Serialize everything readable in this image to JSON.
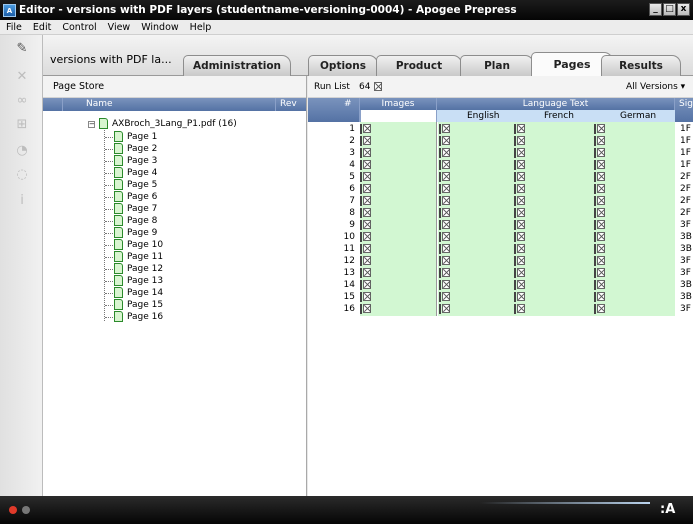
{
  "window": {
    "title": "Editor - versions with PDF layers (studentname-versioning-0004) - Apogee Prepress",
    "app_icon": "A",
    "minimize_label": "_",
    "restore_label": "□",
    "close_label": "x"
  },
  "menu": {
    "items": [
      "File",
      "Edit",
      "Control",
      "View",
      "Window",
      "Help"
    ]
  },
  "tabs": {
    "path_label": "versions with PDF la...",
    "items": [
      "Administration",
      "Options",
      "Product",
      "Plan",
      "Pages",
      "Results"
    ],
    "active": "Pages"
  },
  "page_store": {
    "title": "Page Store",
    "col_name": "Name",
    "col_rev": "Rev",
    "root_label": "AXBroch_3Lang_P1.pdf (16)",
    "pages": [
      "Page 1",
      "Page 2",
      "Page 3",
      "Page 4",
      "Page 5",
      "Page 6",
      "Page 7",
      "Page 8",
      "Page 9",
      "Page 10",
      "Page 11",
      "Page 12",
      "Page 13",
      "Page 14",
      "Page 15",
      "Page 16"
    ]
  },
  "run_list": {
    "label": "Run List",
    "count": "64",
    "versions_dropdown": "All Versions"
  },
  "grid": {
    "header_num": "#",
    "header_images": "Images",
    "header_language_text": "Language Text",
    "header_sig": "Sig",
    "sub_english": "English",
    "sub_french": "French",
    "sub_german": "German",
    "rows": [
      {
        "num": "1",
        "sig": "1F"
      },
      {
        "num": "2",
        "sig": "1F"
      },
      {
        "num": "3",
        "sig": "1F"
      },
      {
        "num": "4",
        "sig": "1F"
      },
      {
        "num": "5",
        "sig": "2F"
      },
      {
        "num": "6",
        "sig": "2F"
      },
      {
        "num": "7",
        "sig": "2F"
      },
      {
        "num": "8",
        "sig": "2F"
      },
      {
        "num": "9",
        "sig": "3F"
      },
      {
        "num": "10",
        "sig": "3B"
      },
      {
        "num": "11",
        "sig": "3B"
      },
      {
        "num": "12",
        "sig": "3F"
      },
      {
        "num": "13",
        "sig": "3F"
      },
      {
        "num": "14",
        "sig": "3B"
      },
      {
        "num": "15",
        "sig": "3B"
      },
      {
        "num": "16",
        "sig": "3F"
      }
    ]
  },
  "footer": {
    "brand_mark": ":A"
  },
  "colors": {
    "header_blue": "#5f7cad",
    "cell_green": "#d2f7d2",
    "title_black": "#0a0a0a"
  },
  "icons": [
    "pin-icon",
    "delete-icon",
    "link-icon",
    "tree-icon",
    "thumb-icon",
    "search-icon",
    "info-icon"
  ]
}
